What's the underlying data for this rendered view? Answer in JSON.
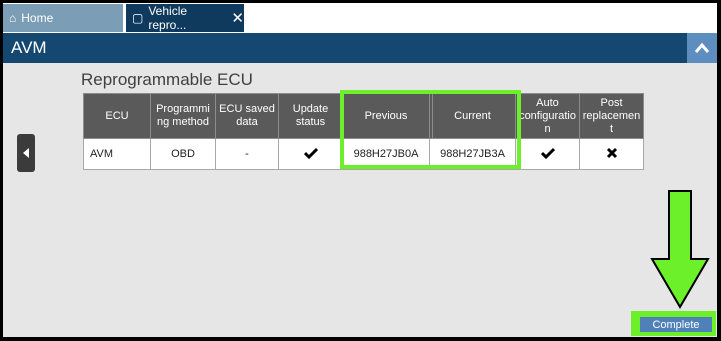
{
  "tabs": [
    {
      "label": "Home",
      "icon": "home-icon"
    },
    {
      "label": "Vehicle repro...",
      "icon": "window-icon",
      "close_glyph": "✕"
    }
  ],
  "title_bar": {
    "title": "AVM",
    "collapse_icon": "chevron-up-icon"
  },
  "section": {
    "title": "Reprogrammable ECU",
    "columns": [
      "ECU",
      "Programmi ng method",
      "ECU saved data",
      "Update status",
      "Previous",
      "Current",
      "Auto configuratio n",
      "Post replacemen t"
    ],
    "rows": [
      {
        "ecu": "AVM",
        "method": "OBD",
        "saved": "-",
        "update_status": "check",
        "previous": "988H27JB0A",
        "current": "988H27JB3A",
        "auto_config": "check",
        "post_replacement": "cross"
      }
    ]
  },
  "side_nav": {
    "icon": "caret-left-icon"
  },
  "footer": {
    "complete_label": "Complete"
  },
  "colors": {
    "highlight": "#6cf02a",
    "header_bg": "#154870",
    "table_header": "#5a5a5a",
    "button": "#4f80b7"
  }
}
